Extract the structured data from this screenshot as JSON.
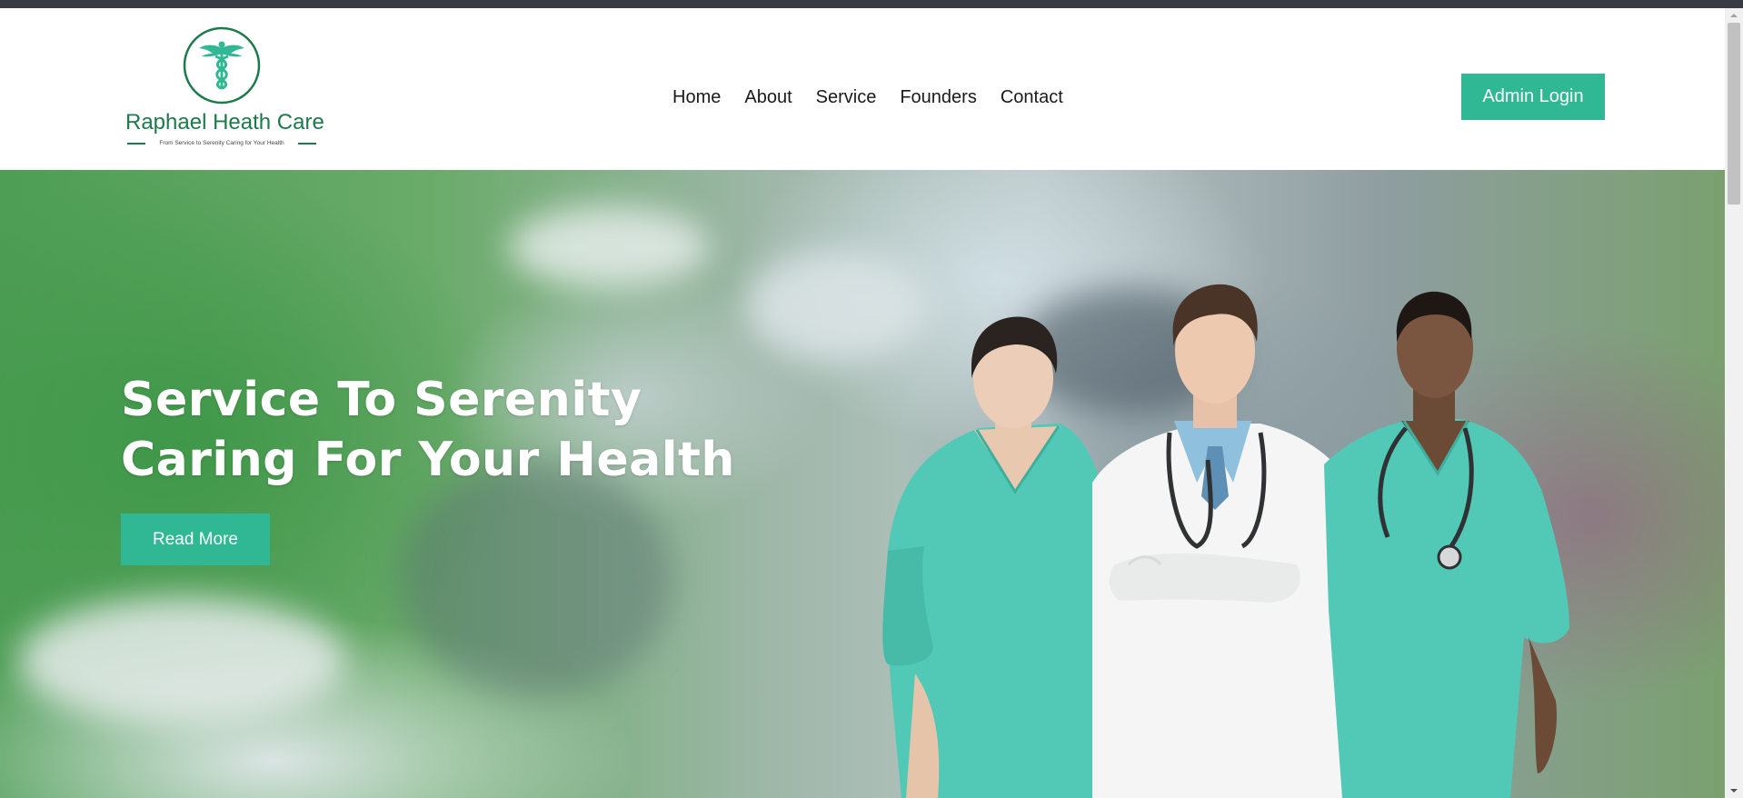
{
  "brand": {
    "name": "Raphael Heath Care",
    "tagline": "From Service to Serenity Caring for Your Health",
    "logo_icon": "caduceus-icon",
    "color": "#1d7a4a"
  },
  "nav": {
    "items": [
      {
        "label": "Home"
      },
      {
        "label": "About"
      },
      {
        "label": "Service"
      },
      {
        "label": "Founders"
      },
      {
        "label": "Contact"
      }
    ]
  },
  "header": {
    "admin_login_label": "Admin Login"
  },
  "hero": {
    "title_line1": "Service To Serenity",
    "title_line2": "Caring For Your Health",
    "read_more_label": "Read More",
    "image_description_icon": "doctors-group-photo"
  },
  "colors": {
    "accent": "#2fb893",
    "brand_green": "#1d7a4a",
    "scrub_teal": "#52c8b6",
    "top_bar": "#383a44"
  }
}
